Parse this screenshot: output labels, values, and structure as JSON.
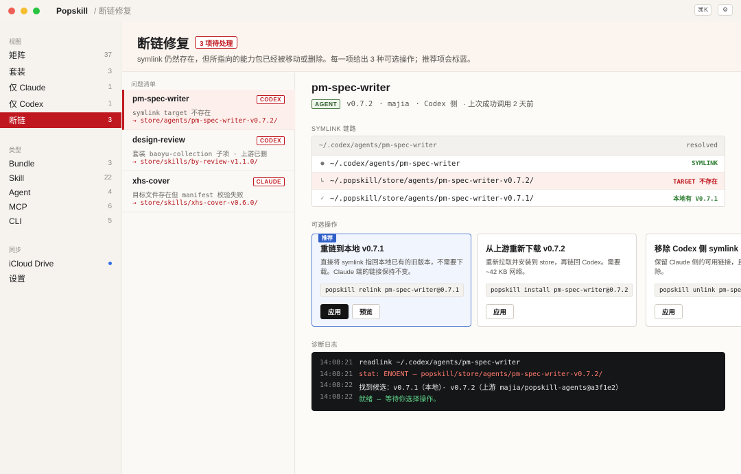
{
  "titlebar": {
    "app_name": "Popskill",
    "breadcrumb": "/ 断链修复",
    "shortcut": "⌘K",
    "settings_icon": "⚙"
  },
  "sidebar": {
    "groups": [
      {
        "label": "视图",
        "items": [
          {
            "label": "矩阵",
            "count": "37"
          },
          {
            "label": "套装",
            "count": "3"
          },
          {
            "label": "仅 Claude",
            "count": "1"
          },
          {
            "label": "仅 Codex",
            "count": "1"
          },
          {
            "label": "断链",
            "count": "3",
            "active": true
          }
        ]
      },
      {
        "label": "类型",
        "items": [
          {
            "label": "Bundle",
            "count": "3"
          },
          {
            "label": "Skill",
            "count": "22"
          },
          {
            "label": "Agent",
            "count": "4"
          },
          {
            "label": "MCP",
            "count": "6"
          },
          {
            "label": "CLI",
            "count": "5"
          }
        ]
      },
      {
        "label": "同步",
        "items": [
          {
            "label": "iCloud Drive",
            "indicator": "dot"
          },
          {
            "label": "设置"
          }
        ]
      }
    ]
  },
  "header": {
    "title": "断链修复",
    "badge": "3 项待处理",
    "subtitle": "symlink 仍然存在，但所指向的能力包已经被移动或删除。每一项给出 3 种可选操作；推荐项会标蓝。"
  },
  "issues": {
    "label": "问题清单",
    "items": [
      {
        "name": "pm-spec-writer",
        "tag": "CODEX",
        "desc": "symlink target 不存在",
        "path": "→ store/agents/pm-spec-writer-v0.7.2/",
        "active": true
      },
      {
        "name": "design-review",
        "tag": "CODEX",
        "desc": "套装 baoyu-collection 子项 · 上游已删",
        "path": "→ store/skills/by-review-v1.1.0/"
      },
      {
        "name": "xhs-cover",
        "tag": "CLAUDE",
        "desc": "目标文件存在但 manifest 校验失败",
        "path": "→ store/skills/xhs-cover-v0.6.0/"
      }
    ]
  },
  "detail": {
    "title": "pm-spec-writer",
    "type_badge": "AGENT",
    "version": "v0.7.2",
    "author": "· majia",
    "side": "· Codex 侧",
    "last_call": "· 上次成功调用 2 天前",
    "chain_label": "SYMLINK 链路",
    "chain": {
      "head_path": "~/.codex/agents/pm-spec-writer",
      "head_status": "resolved",
      "rows": [
        {
          "mark": "●",
          "path": "~/.codex/agents/pm-spec-writer",
          "status": "SYMLINK",
          "kind": "ok"
        },
        {
          "mark": "↳",
          "path": "~/.popskill/store/agents/pm-spec-writer-v0.7.2/",
          "status": "TARGET 不存在",
          "kind": "bad"
        },
        {
          "mark": "✓",
          "path": "~/.popskill/store/agents/pm-spec-writer-v0.7.1/",
          "status": "本地有 V0.7.1",
          "kind": "ok"
        }
      ]
    },
    "options_label": "可选操作",
    "options": [
      {
        "recommended": true,
        "rec_label": "推荐",
        "title": "重链到本地 v0.7.1",
        "desc": "直接将 symlink 指回本地已有的旧版本，不需要下载。Claude 端的链接保持不变。",
        "command": "popskill relink pm-spec-writer@0.7.1",
        "buttons": [
          "应用",
          "预览"
        ]
      },
      {
        "title": "从上游重新下载 v0.7.2",
        "desc": "重新拉取并安装到 store，再链回 Codex。需要 ~42 KB 网络。",
        "command": "popskill install pm-spec-writer@0.7.2",
        "buttons": [
          "应用"
        ]
      },
      {
        "title": "移除 Codex 侧 symlink",
        "desc": "保留 Claude 侧的可用链接，且对应的旧版本不删除。",
        "command": "popskill unlink pm-spec-writer",
        "buttons": [
          "应用"
        ]
      }
    ],
    "log_label": "诊断日志",
    "log": [
      {
        "time": "14:08:21",
        "text": "readlink ~/.codex/agents/pm-spec-writer",
        "kind": "normal"
      },
      {
        "time": "14:08:21",
        "text": "stat: ENOENT — popskill/store/agents/pm-spec-writer-v0.7.2/",
        "kind": "error"
      },
      {
        "time": "14:08:22",
        "text": "找到候选：v0.7.1（本地）· v0.7.2（上游 majia/popskill-agents@a3f1e2）",
        "kind": "normal"
      },
      {
        "time": "14:08:22",
        "text": "就绪 — 等待你选择操作。",
        "kind": "ok"
      }
    ]
  }
}
